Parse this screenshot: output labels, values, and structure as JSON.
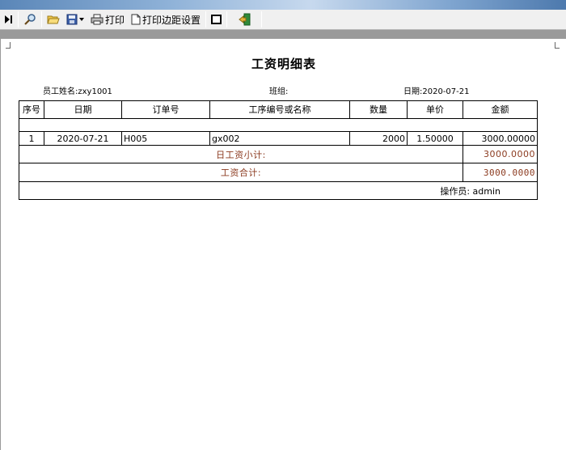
{
  "toolbar": {
    "print_label": "打印",
    "margin_label": "打印边距设置"
  },
  "report": {
    "title": "工资明细表",
    "employee": "员工姓名:zxy1001",
    "team": "班组:",
    "date": "日期:2020-07-21"
  },
  "table": {
    "headers": [
      "序号",
      "日期",
      "订单号",
      "工序编号或名称",
      "数量",
      "单价",
      "金额"
    ],
    "rows": [
      [
        "1",
        "2020-07-21",
        "H005",
        "gx002",
        "2000",
        "1.50000",
        "3000.00000"
      ]
    ],
    "daily_subtotal_label": "日工资小计:",
    "daily_subtotal_value": "3000.0000",
    "total_label": "工资合计:",
    "total_value": "3000.0000",
    "operator": "操作员: admin"
  },
  "colors": {
    "accent_brown": "#8b3a1f",
    "toolbar_bg": "#f0f0f0"
  }
}
